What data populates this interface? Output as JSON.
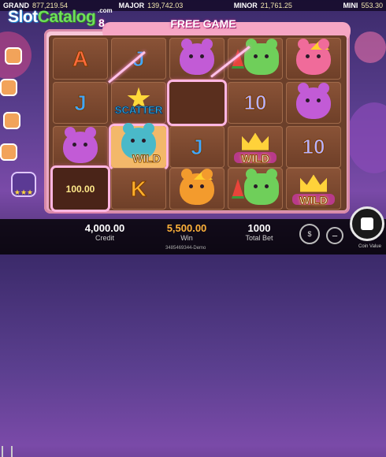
{
  "jackpots": [
    {
      "label": "GRAND",
      "value": "877,219.54"
    },
    {
      "label": "MAJOR",
      "value": "139,742.03"
    },
    {
      "label": "MINOR",
      "value": "21,761.25"
    },
    {
      "label": "MINI",
      "value": "553.30"
    }
  ],
  "logo": {
    "part1": "Slot",
    "part2": "Catalog",
    "suffix": ".com"
  },
  "title": {
    "count": "8",
    "text": "FREE GAME"
  },
  "grid": {
    "rows": [
      [
        "A",
        "J",
        "bear-purple",
        "watermelon-bear-green",
        "bear-pink-crown"
      ],
      [
        "J",
        "SCATTER",
        "empty",
        "10",
        "bear-purple"
      ],
      [
        "bear-purple",
        "bear-blue-wild",
        "J",
        "WILD",
        "10"
      ],
      [
        "100.00",
        "K",
        "bear-orange-king",
        "watermelon-bear-green",
        "WILD"
      ]
    ],
    "scatter_label": "SCATTER",
    "wild_label": "WILD",
    "prize_value": "100.00"
  },
  "footer": {
    "credit_value": "4,000.00",
    "credit_label": "Credit",
    "win_value": "5,500.00",
    "win_label": "Win",
    "bet_value": "1000",
    "bet_label": "Total Bet",
    "version": "3485469344-Demo",
    "coin_value_label": "Coin Value"
  },
  "colors": {
    "win": "#ffb23a",
    "highlight": "#ffb6e1",
    "frame": "#f7c7d9"
  }
}
